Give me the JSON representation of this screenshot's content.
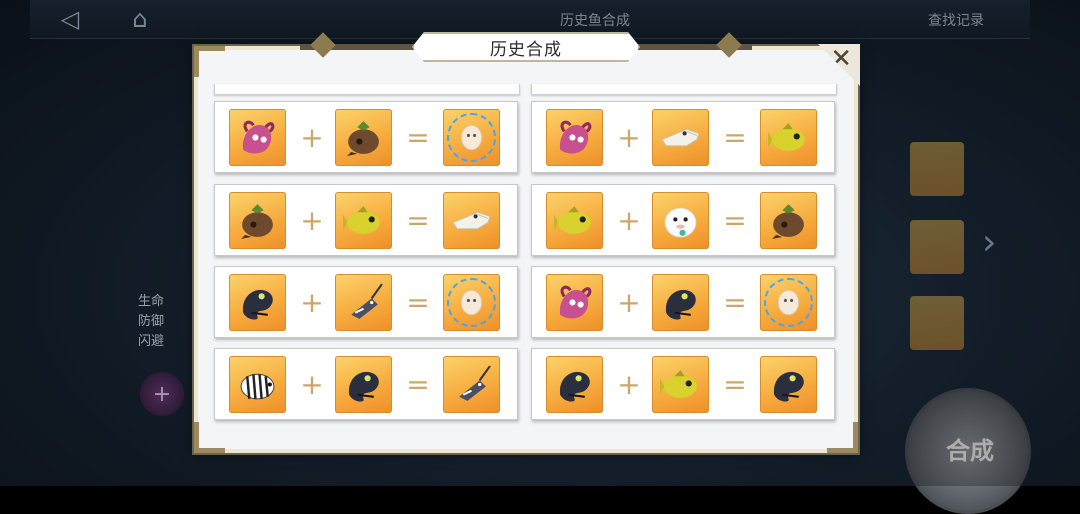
{
  "background": {
    "title": "历史鱼合成",
    "search_label": "查找记录",
    "stats": [
      "生命",
      "防御",
      "闪避"
    ],
    "compose_label": "合成"
  },
  "dialog": {
    "title": "历史合成",
    "close_icon": "close-icon"
  },
  "recipes": [
    {
      "a": "pink-squid",
      "b": "coconut-fish",
      "result": "cotton-puff-selected"
    },
    {
      "a": "pink-squid",
      "b": "white-crocodile",
      "result": "yellow-wrasse"
    },
    {
      "a": "coconut-fish",
      "b": "yellow-wrasse",
      "result": "white-crocodile"
    },
    {
      "a": "yellow-wrasse",
      "b": "white-seal",
      "result": "coconut-fish"
    },
    {
      "a": "black-eel",
      "b": "swordfish",
      "result": "cotton-puff-selected"
    },
    {
      "a": "pink-squid",
      "b": "black-eel",
      "result": "cotton-puff-selected"
    },
    {
      "a": "zebra-fish",
      "b": "black-eel",
      "result": "swordfish"
    },
    {
      "a": "black-eel",
      "b": "yellow-wrasse",
      "result": "black-eel"
    }
  ],
  "colors": {
    "slot_top": "#fbd46c",
    "slot_bottom": "#ee8f2a",
    "operator": "#c9a86a",
    "frame_gold": "#9c8a5e"
  }
}
